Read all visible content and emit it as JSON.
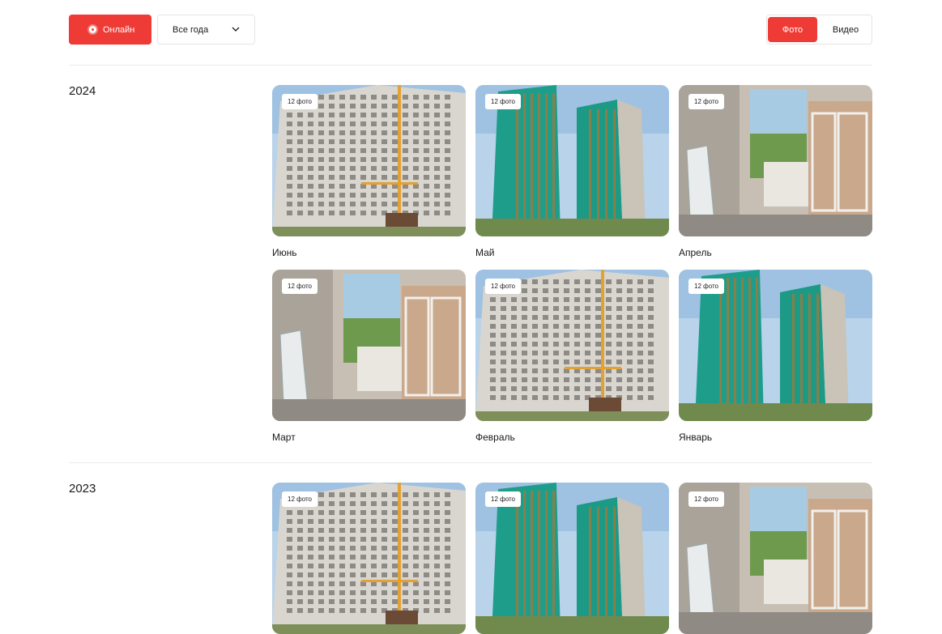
{
  "toolbar": {
    "online_label": "Онлайн",
    "year_select_value": "Все года",
    "tab_photo": "Фото",
    "tab_video": "Видео"
  },
  "colors": {
    "accent": "#ef3b36",
    "divider": "#ececec",
    "border": "#e4e4e4"
  },
  "groups": [
    {
      "year": "2024",
      "items": [
        {
          "month": "Июнь",
          "badge": "12 фото",
          "scene": "building-white"
        },
        {
          "month": "Май",
          "badge": "12 фото",
          "scene": "building-green"
        },
        {
          "month": "Апрель",
          "badge": "12 фото",
          "scene": "interior"
        },
        {
          "month": "Март",
          "badge": "12 фото",
          "scene": "interior"
        },
        {
          "month": "Февраль",
          "badge": "12 фото",
          "scene": "building-white"
        },
        {
          "month": "Январь",
          "badge": "12 фото",
          "scene": "building-green"
        }
      ]
    },
    {
      "year": "2023",
      "items": [
        {
          "month": "",
          "badge": "12 фото",
          "scene": "building-white"
        },
        {
          "month": "",
          "badge": "12 фото",
          "scene": "building-green"
        },
        {
          "month": "",
          "badge": "12 фото",
          "scene": "interior"
        }
      ]
    }
  ],
  "icons": {
    "online": "record-dot-icon",
    "select": "chevron-down-icon"
  }
}
